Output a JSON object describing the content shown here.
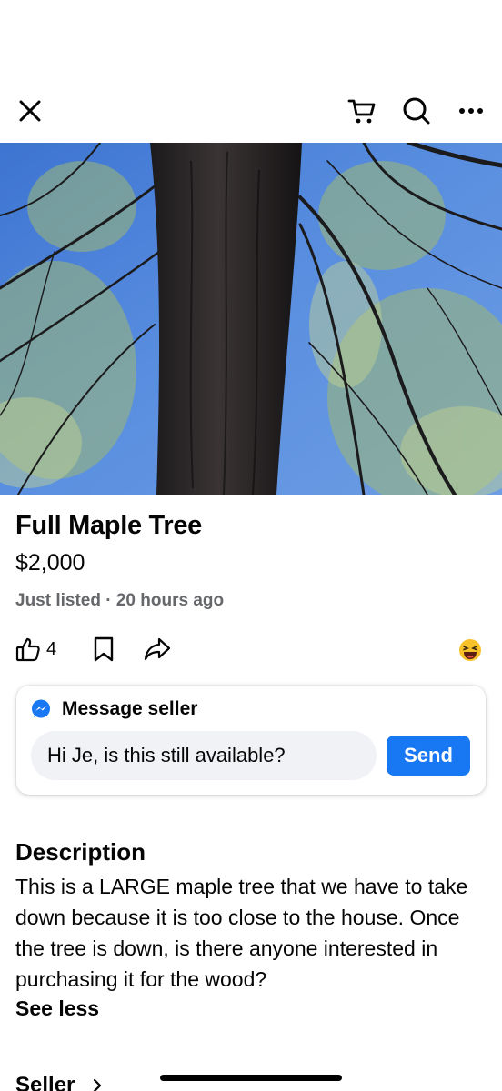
{
  "listing": {
    "title": "Full Maple Tree",
    "price": "$2,000",
    "meta": "Just listed · 20 hours ago"
  },
  "actions": {
    "like_count": "4"
  },
  "message": {
    "header": "Message seller",
    "input_value": "Hi Je, is this still available?",
    "send_label": "Send"
  },
  "description": {
    "heading": "Description",
    "body": "This is a LARGE maple tree that we have to take down because it is too close to the house. Once the tree is down, is there anyone interested in purchasing it for the wood?",
    "toggle": "See less"
  },
  "seller": {
    "heading": "Seller"
  },
  "icons": {
    "close": "close-icon",
    "cart": "cart-icon",
    "search": "search-icon",
    "more": "more-icon",
    "like": "thumbs-up-icon",
    "save": "bookmark-icon",
    "share": "share-icon",
    "emoji": "laughing-emoji-icon",
    "messenger": "messenger-icon",
    "seller_chevron": "chevron-right-icon"
  },
  "colors": {
    "accent": "#1877f2",
    "secondary_text": "#65676b",
    "input_bg": "#f0f2f5"
  }
}
